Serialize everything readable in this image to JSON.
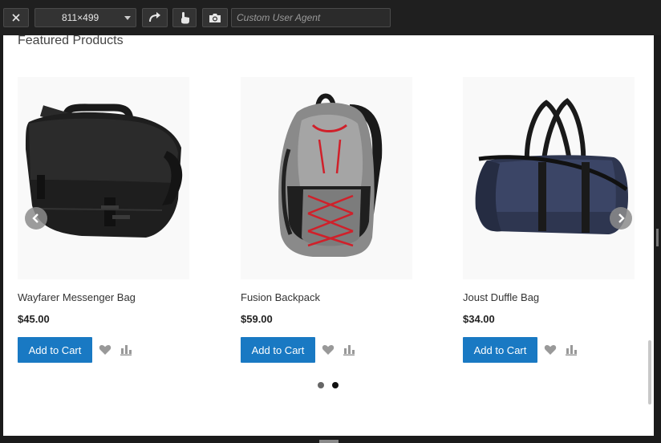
{
  "toolbar": {
    "close_icon": "close-icon",
    "device_size": "811×499",
    "rotate_icon": "rotate-icon",
    "touch_icon": "touch-icon",
    "screenshot_icon": "camera-icon",
    "user_agent_placeholder": "Custom User Agent"
  },
  "section": {
    "title": "Featured Products"
  },
  "products": [
    {
      "name": "Wayfarer Messenger Bag",
      "price": "$45.00",
      "cta": "Add to Cart"
    },
    {
      "name": "Fusion Backpack",
      "price": "$59.00",
      "cta": "Add to Cart"
    },
    {
      "name": "Joust Duffle Bag",
      "price": "$34.00",
      "cta": "Add to Cart"
    }
  ],
  "carousel": {
    "slide_count": 2,
    "active_slide": 2
  },
  "colors": {
    "primary_button": "#1979c3",
    "action_icon": "#999999"
  }
}
